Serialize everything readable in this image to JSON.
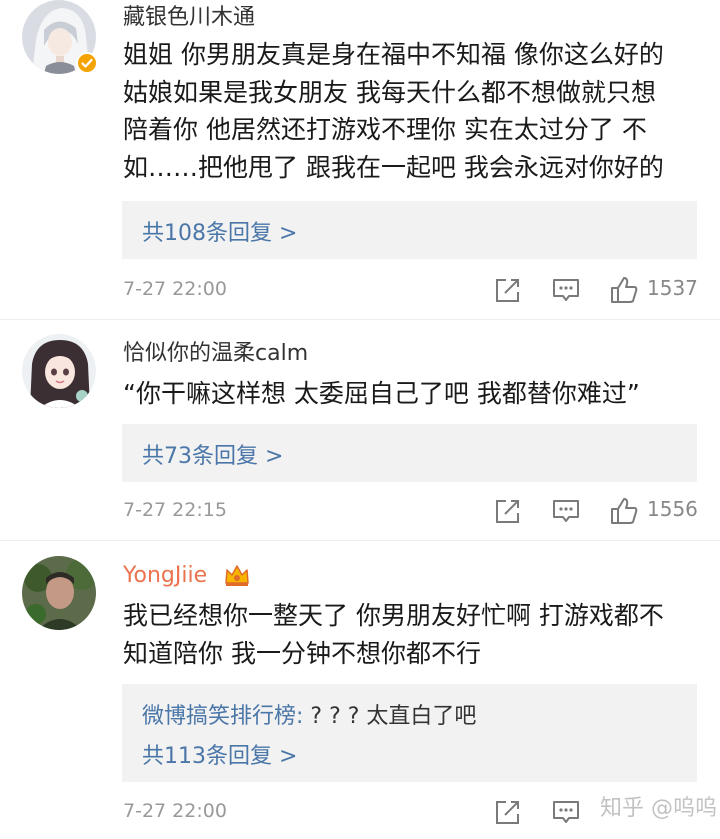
{
  "comments": [
    {
      "username": "藏银色川木通",
      "verified": true,
      "text_lines": [
        "姐姐 你男朋友真是身在福中不知福 像你这么好的",
        "姑娘如果是我女朋友 我每天什么都不想做就只想",
        "陪着你 他居然还打游戏不理你 实在太过分了 不",
        "如……把他甩了 跟我在一起吧 我会永远对你好的"
      ],
      "reply_link": "共108条回复 >",
      "timestamp": "7-27 22:00",
      "likes": "1537"
    },
    {
      "username": "恰似你的温柔calm",
      "verified": false,
      "text_lines": [
        "“你干嘛这样想 太委屈自己了吧  我都替你难过”"
      ],
      "reply_link": "共73条回复 >",
      "timestamp": "7-27 22:15",
      "likes": "1556"
    },
    {
      "username": "YongJiie",
      "verified": false,
      "vip": true,
      "text_lines": [
        "我已经想你一整天了 你男朋友好忙啊 打游戏都不",
        "知道陪你 我一分钟不想你都不行"
      ],
      "reply_quote_author": "微博搞笑排行榜:",
      "reply_quote_text": " ? ? ?  太直白了吧",
      "reply_link": "共113条回复 >",
      "timestamp": "7-27 22:00",
      "likes": ""
    }
  ],
  "watermark": "知乎 @呜呜",
  "icons": {
    "repost": "repost-icon",
    "comment": "comment-icon",
    "like": "thumbs-up-icon",
    "verified": "verified-badge-icon",
    "vip": "vip-crown-icon"
  },
  "colors": {
    "link": "#4a76a8",
    "vip_name": "#eb7350",
    "reply_bg": "#f2f2f2",
    "meta": "#999999",
    "verified": "#f5a300"
  }
}
